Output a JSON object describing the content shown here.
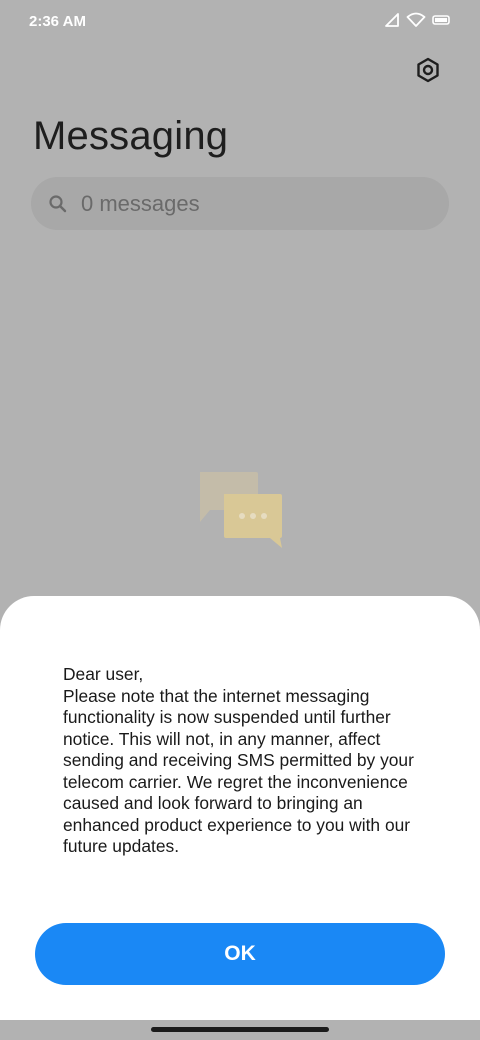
{
  "status_bar": {
    "time": "2:36 AM",
    "icons": [
      "signal-icon",
      "wifi-icon",
      "battery-icon"
    ]
  },
  "header": {
    "settings_icon": "gear-icon",
    "title": "Messaging"
  },
  "search": {
    "icon": "search-icon",
    "text": "0 messages"
  },
  "empty_state": {
    "icon": "chat-bubbles-icon"
  },
  "dialog": {
    "greeting": "Dear user,",
    "body": "Please note that the internet messaging functionality is now suspended until further notice. This will not, in any manner, affect sending and receiving SMS permitted by your telecom carrier. We regret the inconvenience caused and look forward to bringing an enhanced product experience to you with our future updates.",
    "ok_label": "OK"
  },
  "colors": {
    "background_dim": "#b2b2b2",
    "accent": "#1a88f5",
    "sheet": "#ffffff",
    "illustration": "#e2cfa0"
  }
}
